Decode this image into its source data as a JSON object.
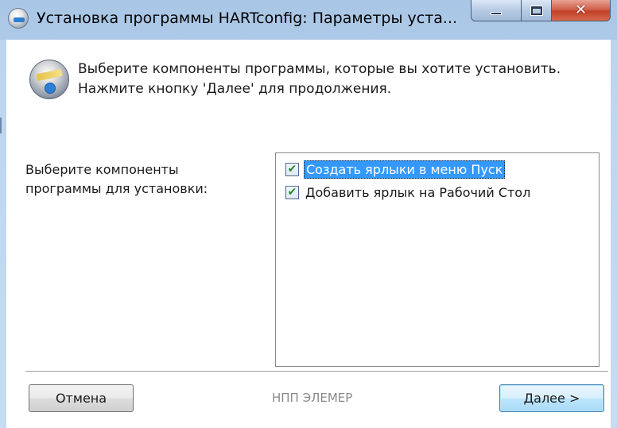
{
  "window": {
    "title": "Установка программы HARTconfig: Параметры уста..."
  },
  "header": {
    "line1": "Выберите компоненты программы, которые вы хотите установить.",
    "line2": "Нажмите кнопку 'Далее' для продолжения."
  },
  "components": {
    "prompt_line1": "Выберите компоненты",
    "prompt_line2": "программы для установки:",
    "items": [
      {
        "label": "Создать ярлыки в меню Пуск",
        "checked": true,
        "selected": true
      },
      {
        "label": "Добавить ярлык на Рабочий Стол",
        "checked": true,
        "selected": false
      }
    ]
  },
  "footer": {
    "cancel_label": "Отмена",
    "company": "НПП ЭЛЕМЕР",
    "next_label": "Далее >"
  },
  "icons": {
    "app": "installer-disc-icon",
    "header": "installer-disc-icon",
    "check": "checkmark-icon"
  }
}
